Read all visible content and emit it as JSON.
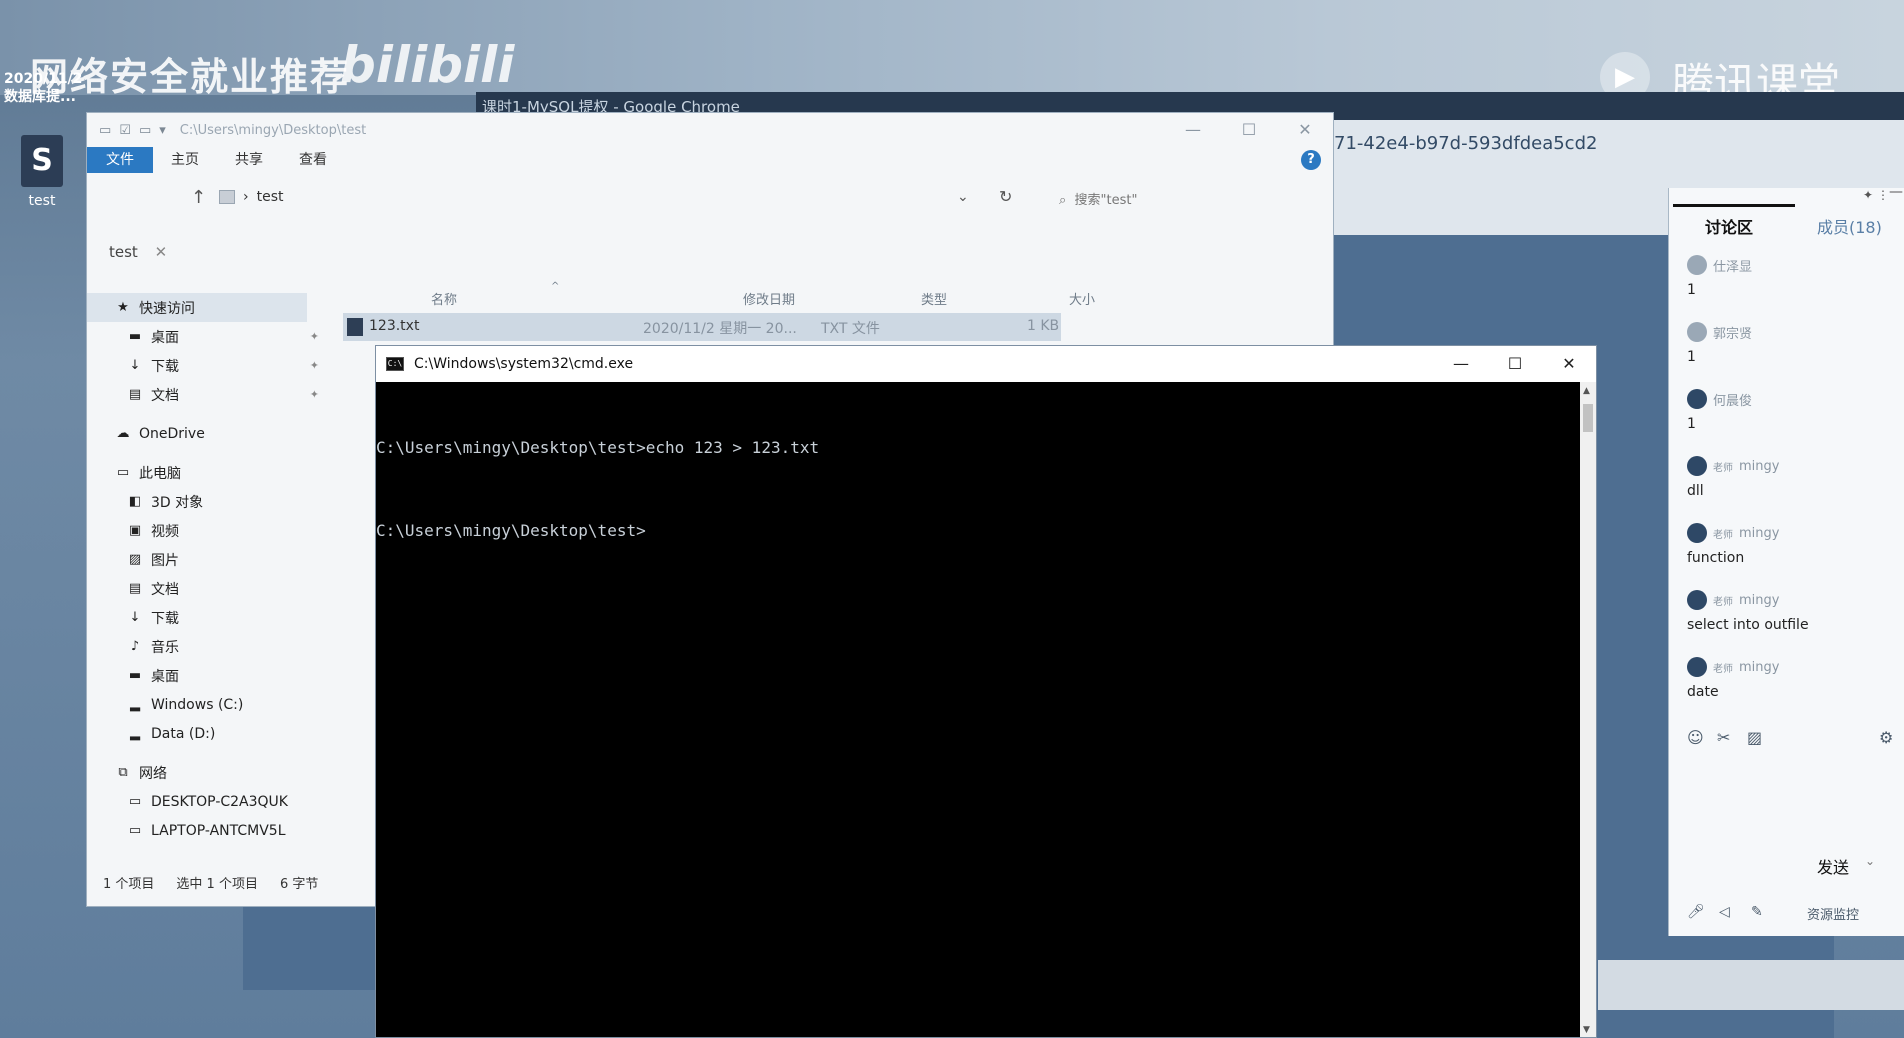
{
  "desktop": {
    "date_text": "2020/11/2",
    "date_sub": "数据库提...",
    "icon_label": "test",
    "watermark_title": "网络安全就业推荐",
    "watermark_bili": "bilibili",
    "watermark_tencent": "腾讯课堂",
    "chrome_tab": "课时1-MySQL提权 - Google Chrome",
    "url_fragment": "71-42e4-b97d-593dfdea5cd2"
  },
  "explorer": {
    "title_path": "C:\\Users\\mingy\\Desktop\\test",
    "ribbon": {
      "file": "文件",
      "home": "主页",
      "share": "共享",
      "view": "查看",
      "help": "?"
    },
    "address": {
      "crumb": "test",
      "search_placeholder": "搜索\"test\""
    },
    "path_tab": "test",
    "nav": {
      "quick_access": "快速访问",
      "qa_items": [
        "桌面",
        "下载",
        "文档"
      ],
      "onedrive": "OneDrive",
      "this_pc": "此电脑",
      "pc_items": [
        "3D 对象",
        "视频",
        "图片",
        "文档",
        "下载",
        "音乐",
        "桌面",
        "Windows (C:)",
        "Data (D:)"
      ],
      "network": "网络",
      "net_items": [
        "DESKTOP-C2A3QUK",
        "LAPTOP-ANTCMV5L"
      ]
    },
    "columns": {
      "name": "名称",
      "modified": "修改日期",
      "type": "类型",
      "size": "大小"
    },
    "file": {
      "name": "123.txt",
      "modified": "2020/11/2 星期一 20...",
      "type": "TXT 文件",
      "size": "1 KB"
    },
    "status": {
      "count": "1 个项目",
      "selected": "选中 1 个项目",
      "bytes": "6 字节"
    }
  },
  "cmd": {
    "title": "C:\\Windows\\system32\\cmd.exe",
    "lines": [
      "C:\\Users\\mingy\\Desktop\\test>echo 123 > 123.txt",
      "C:\\Users\\mingy\\Desktop\\test>"
    ]
  },
  "chat": {
    "tab_discussion": "讨论区",
    "tab_members": "成员(18)",
    "messages": [
      {
        "user": "仕泽显",
        "role": "",
        "text": "1"
      },
      {
        "user": "郭宗贤",
        "role": "",
        "text": "1"
      },
      {
        "user": "何晨俊",
        "role": "",
        "text": "1"
      },
      {
        "user": "mingy",
        "role": "老师",
        "text": "dll"
      },
      {
        "user": "mingy",
        "role": "老师",
        "text": "function"
      },
      {
        "user": "mingy",
        "role": "老师",
        "text": "select into outfile"
      },
      {
        "user": "mingy",
        "role": "老师",
        "text": "date"
      }
    ],
    "send_label": "发送",
    "monitor_label": "资源监控"
  },
  "colors": {
    "accent": "#2b79c2",
    "cmd_bg": "#000000",
    "cmd_text": "#c8d0d8"
  }
}
